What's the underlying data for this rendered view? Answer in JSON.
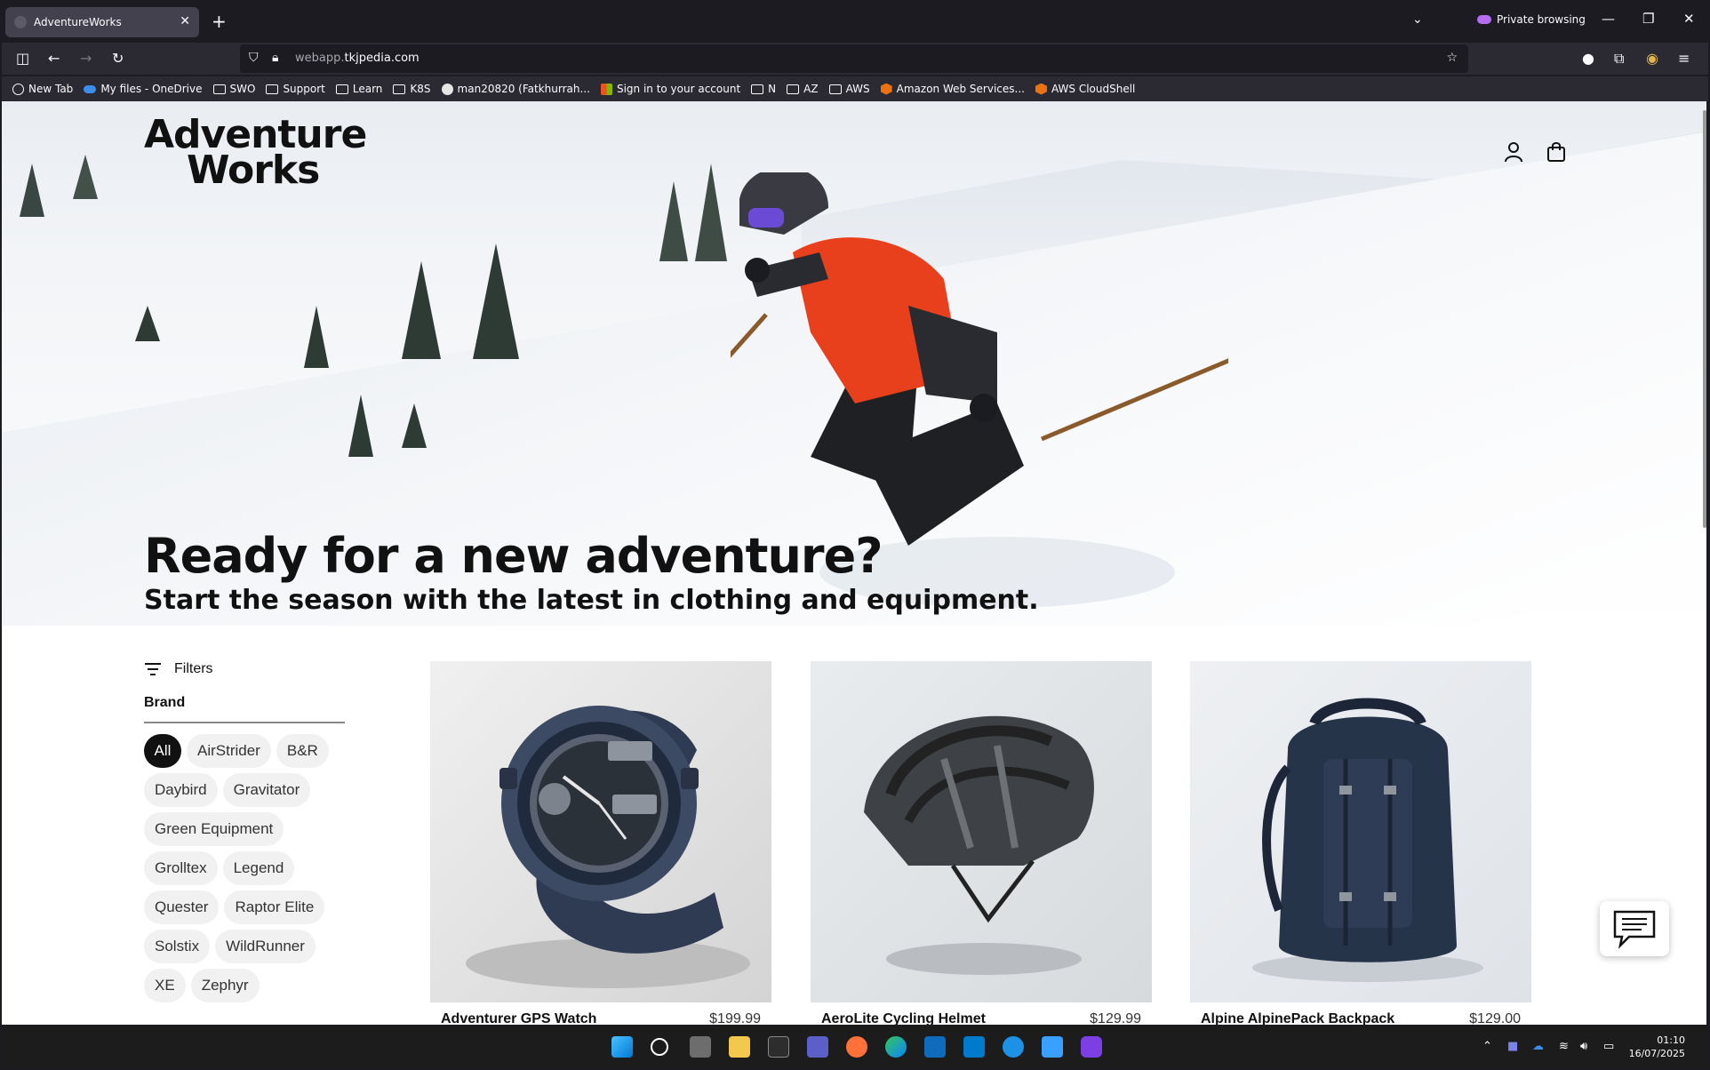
{
  "browser": {
    "tab_title": "AdventureWorks",
    "private_label": "Private browsing",
    "url_sub": "webapp.",
    "url_host": "tkjpedia.com",
    "bookmarks": [
      {
        "label": "New Tab",
        "icon": "globe-icon"
      },
      {
        "label": "My files - OneDrive",
        "icon": "onedrive-icon"
      },
      {
        "label": "SWO",
        "icon": "folder-icon"
      },
      {
        "label": "Support",
        "icon": "folder-icon"
      },
      {
        "label": "Learn",
        "icon": "folder-icon"
      },
      {
        "label": "K8S",
        "icon": "folder-icon"
      },
      {
        "label": "man20820 (Fatkhurrah...",
        "icon": "github-icon"
      },
      {
        "label": "Sign in to your account",
        "icon": "microsoft-icon"
      },
      {
        "label": "N",
        "icon": "folder-icon"
      },
      {
        "label": "AZ",
        "icon": "folder-icon"
      },
      {
        "label": "AWS",
        "icon": "folder-icon"
      },
      {
        "label": "Amazon Web Services...",
        "icon": "aws-icon"
      },
      {
        "label": "AWS CloudShell",
        "icon": "aws-icon"
      }
    ]
  },
  "site": {
    "logo_line1": "Adventure",
    "logo_line2": "Works",
    "hero_title": "Ready for a new adventure?",
    "hero_subtitle": "Start the season with the latest in clothing and equipment."
  },
  "filters": {
    "label": "Filters",
    "brand_label": "Brand",
    "brands": [
      "All",
      "AirStrider",
      "B&R",
      "Daybird",
      "Gravitator",
      "Green Equipment",
      "Grolltex",
      "Legend",
      "Quester",
      "Raptor Elite",
      "Solstix",
      "WildRunner",
      "XE",
      "Zephyr"
    ],
    "selected": "All"
  },
  "products": [
    {
      "name": "Adventurer GPS Watch",
      "price": "$199.99"
    },
    {
      "name": "AeroLite Cycling Helmet",
      "price": "$129.99"
    },
    {
      "name": "Alpine AlpinePack Backpack",
      "price": "$129.00"
    }
  ],
  "taskbar": {
    "time": "01:10",
    "date": "16/07/2025"
  }
}
